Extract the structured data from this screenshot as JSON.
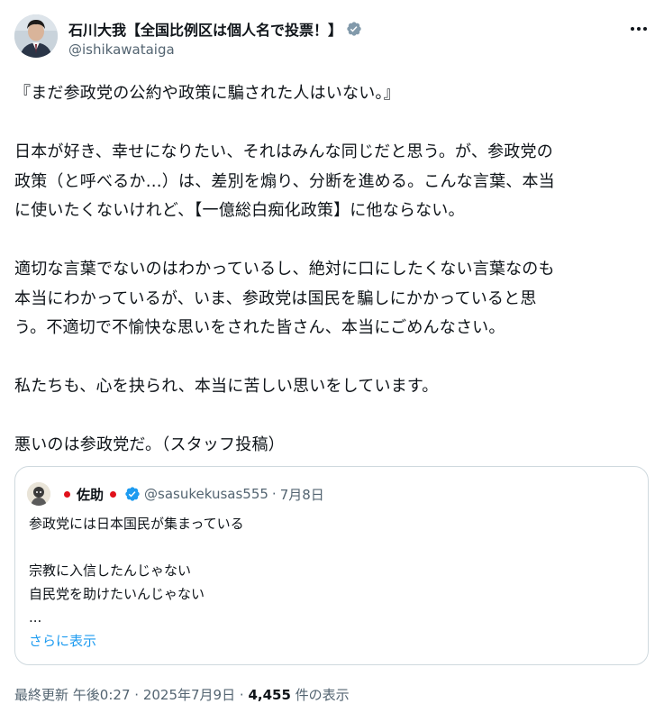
{
  "author": {
    "display_name": "石川大我【全国比例区は個人名で投票！】",
    "handle": "@ishikawataiga",
    "verified": true
  },
  "tweet": {
    "paragraphs": [
      [
        "『まだ参政党の公約や政策に騙された人はいない。』"
      ],
      [
        "日本が好き、幸せになりたい、それはみんな同じだと思う。が、参政党の",
        "政策（と呼べるか…）は、差別を煽り、分断を進める。こんな言葉、本当",
        "に使いたくないけれど、【一億総白痴化政策】に他ならない。"
      ],
      [
        "適切な言葉でないのはわかっているし、絶対に口にしたくない言葉なのも",
        "本当にわかっているが、いま、参政党は国民を騙しにかかっていると思",
        "う。不適切で不愉快な思いをされた皆さん、本当にごめんなさい。"
      ],
      [
        "私たちも、心を抉られ、本当に苦しい思いをしています。"
      ],
      [
        "悪いのは参政党だ。（スタッフ投稿）"
      ]
    ]
  },
  "quoted": {
    "display_name": "佐助",
    "handle": "@sasukekusas555",
    "separator": "·",
    "date": "7月8日",
    "verified": true,
    "lines": [
      "参政党には日本国民が集まっている",
      "",
      "宗教に入信したんじゃない",
      "自民党を助けたいんじゃない",
      "..."
    ],
    "show_more": "さらに表示"
  },
  "meta": {
    "updated_label": "最終更新",
    "time": "午後0:27",
    "separator": "·",
    "date": "2025年7月9日",
    "views": "4,455",
    "views_label": "件の表示"
  },
  "colors": {
    "accent": "#1d9bf0",
    "secondary_text": "#536471",
    "primary_text": "#0f1419",
    "verified_badge_author": "#829aab",
    "verified_badge_quoted": "#1d9bf0"
  },
  "icons": {
    "author_badge": "verified-badge-gray-icon",
    "quoted_badge": "verified-badge-blue-icon",
    "more": "more-horizontal-icon",
    "flag": "japan-flag-icon"
  }
}
